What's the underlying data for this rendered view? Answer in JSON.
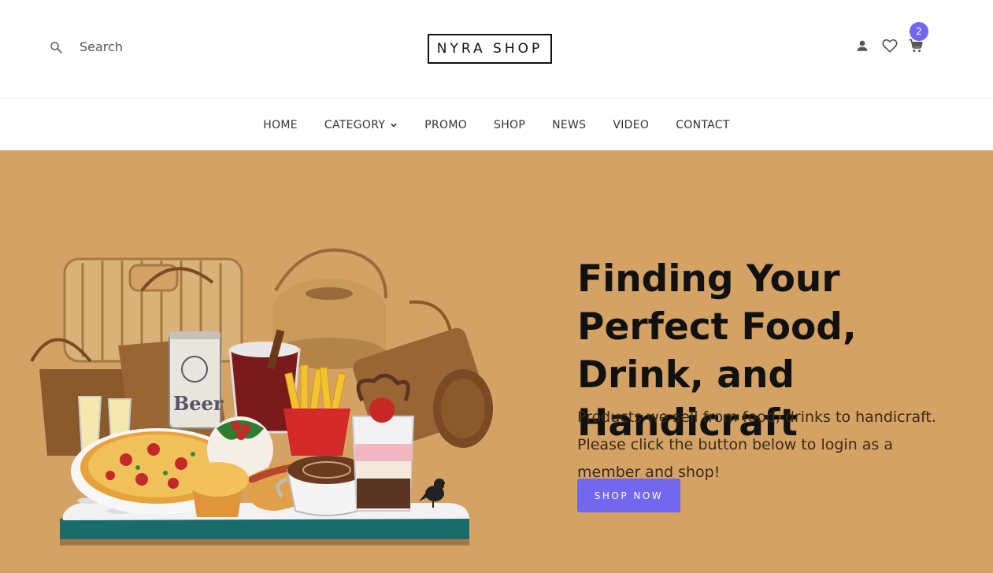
{
  "header": {
    "search_label": "Search",
    "logo_text": "NYRA SHOP",
    "cart_count": "2",
    "icons": [
      "search-icon",
      "user-icon",
      "heart-icon",
      "cart-icon"
    ]
  },
  "nav": {
    "items": [
      {
        "label": "HOME"
      },
      {
        "label": "CATEGORY"
      },
      {
        "label": "PROMO"
      },
      {
        "label": "SHOP"
      },
      {
        "label": "NEWS"
      },
      {
        "label": "VIDEO"
      },
      {
        "label": "CONTACT"
      }
    ]
  },
  "hero": {
    "title": "Finding Your Perfect Food, Drink, and Handicraft",
    "subtitle": "Products we sell from food, drinks to handicraft. Please click the button below to login as a member and shop!",
    "button_label": "SHOP NOW",
    "background_color": "#d4a264",
    "accent_color": "#7367f0",
    "image_label": "Beer"
  }
}
